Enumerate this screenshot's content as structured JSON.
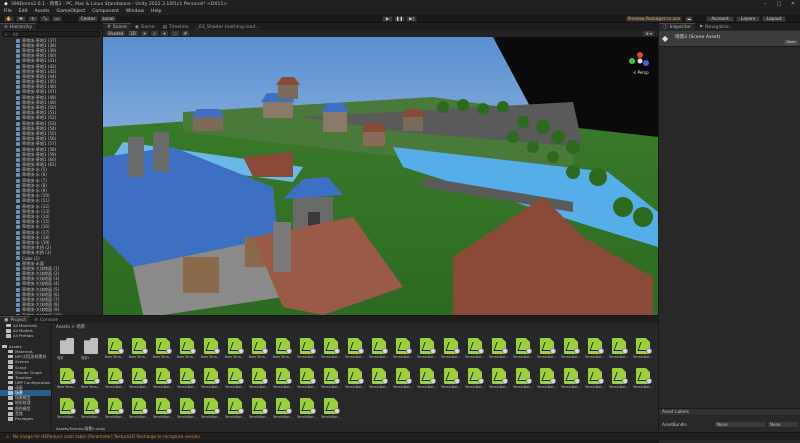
{
  "window": {
    "title": "398Demo2.0.1 - 场景2 - PC, Mac & Linux Standalone - Unity 2022.3.10f1c1 Personal* <DX11>",
    "controls": [
      "–",
      "□",
      "✕"
    ]
  },
  "menu": [
    "File",
    "Edit",
    "Assets",
    "GameObject",
    "Component",
    "Window",
    "Help"
  ],
  "toolbar": {
    "center": "Center",
    "local": "Local",
    "package_notice": "Preview Packages in use",
    "account": "Account",
    "layers": "Layers",
    "layout": "Layout",
    "play": "▶",
    "pause": "❚❚",
    "step": "▶|"
  },
  "hierarchy": {
    "tab": "Hierarchy",
    "search_placeholder": "All",
    "rows": [
      {
        "label": "草地块-草地1 (37)",
        "sel": false
      },
      {
        "label": "草地块-草地1 (38)",
        "sel": false
      },
      {
        "label": "草地块-草地1 (39)",
        "sel": false
      },
      {
        "label": "草地块-草地1 (40)",
        "sel": false
      },
      {
        "label": "草地块-草地1 (41)",
        "sel": false
      },
      {
        "label": "草地块-草地1 (42)",
        "sel": false
      },
      {
        "label": "草地块-草地1 (43)",
        "sel": false
      },
      {
        "label": "草地块-草地1 (44)",
        "sel": false
      },
      {
        "label": "草地块-草地1 (45)",
        "sel": false
      },
      {
        "label": "草地块-草地1 (46)",
        "sel": false
      },
      {
        "label": "草地块-草地1 (47)",
        "sel": false
      },
      {
        "label": "草地块-草地1 (48)",
        "sel": false
      },
      {
        "label": "草地块-草地1 (49)",
        "sel": false
      },
      {
        "label": "草地块-草地1 (50)",
        "sel": false
      },
      {
        "label": "草地块-草地1 (51)",
        "sel": false
      },
      {
        "label": "草地块-草地1 (52)",
        "sel": false
      },
      {
        "label": "草地块-草地1 (53)",
        "sel": false
      },
      {
        "label": "草地块-草地1 (54)",
        "sel": false
      },
      {
        "label": "草地块-草地1 (55)",
        "sel": false
      },
      {
        "label": "草地块-草地1 (56)",
        "sel": false
      },
      {
        "label": "草地块-草地1 (57)",
        "sel": false
      },
      {
        "label": "草地块-草地1 (58)",
        "sel": false
      },
      {
        "label": "草地块-草地1 (59)",
        "sel": false
      },
      {
        "label": "草地块-草地1 (60)",
        "sel": false
      },
      {
        "label": "草地块-草地1 (61)",
        "sel": false
      },
      {
        "label": "草地块-水 (5)",
        "sel": false
      },
      {
        "label": "草地块-水 (6)",
        "sel": false
      },
      {
        "label": "草地块-水 (7)",
        "sel": false
      },
      {
        "label": "草地块-水 (8)",
        "sel": false
      },
      {
        "label": "草地块-水 (9)",
        "sel": false
      },
      {
        "label": "草地块-水 (10)",
        "sel": false
      },
      {
        "label": "草地块-水 (11)",
        "sel": false
      },
      {
        "label": "草地块-水 (12)",
        "sel": false
      },
      {
        "label": "草地块-水 (13)",
        "sel": false
      },
      {
        "label": "草地块-水 (14)",
        "sel": false
      },
      {
        "label": "草地块-水 (15)",
        "sel": false
      },
      {
        "label": "草地块-水 (16)",
        "sel": false
      },
      {
        "label": "草地块-水 (17)",
        "sel": false
      },
      {
        "label": "草地块-水 (18)",
        "sel": false
      },
      {
        "label": "草地块-水 (19)",
        "sel": false
      },
      {
        "label": "草地块-木桥 (2)",
        "sel": false
      },
      {
        "label": "草地块-木桥 (3)",
        "sel": false
      },
      {
        "label": "Cube (1)",
        "sel": false
      },
      {
        "label": "草地块-水面",
        "sel": false
      },
      {
        "label": "草地块-大块地面 (1)",
        "sel": false
      },
      {
        "label": "草地块-大块地面 (2)",
        "sel": false
      },
      {
        "label": "草地块-大块地面 (3)",
        "sel": false
      },
      {
        "label": "草地块-大块地面 (4)",
        "sel": false
      },
      {
        "label": "草地块-大块地面 (5)",
        "sel": false
      },
      {
        "label": "草地块-大块地面 (6)",
        "sel": false
      },
      {
        "label": "草地块-大块地面 (7)",
        "sel": false
      },
      {
        "label": "草地块-大块地面 (8)",
        "sel": false
      },
      {
        "label": "草地块-大块地面 (9)",
        "sel": false
      },
      {
        "label": "草地块-大块地面 (10)",
        "sel": false
      },
      {
        "label": "草地块-大块地面 (11)",
        "sel": false
      },
      {
        "label": "草地块-大块地面 (12)",
        "sel": false
      },
      {
        "label": "草地块-大块地面 (13)",
        "sel": false
      },
      {
        "label": "Timeline",
        "sel": false
      }
    ]
  },
  "scene": {
    "tabs": [
      "Scene",
      "Game",
      "Timeline",
      "_03_Shader (nothing load..."
    ],
    "shading": "Shaded",
    "mode": "2D",
    "camera": "Camera",
    "persp": "< Persp"
  },
  "inspector": {
    "tabs": [
      "Inspector",
      "Navigation"
    ],
    "asset_name": "场景2 (Scene Asset)",
    "open_button": "Open",
    "asset_labels": "Asset Labels",
    "asset_bundle_label": "AssetBundle",
    "asset_bundle_value": "None",
    "variant_value": "None"
  },
  "project": {
    "tabs": [
      "Project",
      "Console"
    ],
    "tree": [
      {
        "label": "All Materials",
        "sel": false
      },
      {
        "label": "All Models",
        "sel": false
      },
      {
        "label": "All Prefabs",
        "sel": false
      },
      {
        "label": "",
        "sel": false
      },
      {
        "label": "Assets",
        "sel": false
      },
      {
        "label": "Materials",
        "sel": false
      },
      {
        "label": "NPC对话系统素材",
        "sel": false
      },
      {
        "label": "Scenes",
        "sel": false
      },
      {
        "label": "Script",
        "sel": false
      },
      {
        "label": "Shader Graph",
        "sel": false
      },
      {
        "label": "Timeline",
        "sel": false
      },
      {
        "label": "URP Configuration",
        "sel": false
      },
      {
        "label": "动画",
        "sel": false
      },
      {
        "label": "场景",
        "sel": true
      },
      {
        "label": "场景模型",
        "sel": false
      },
      {
        "label": "地形纹理",
        "sel": false
      },
      {
        "label": "角色模型",
        "sel": false
      },
      {
        "label": "音效",
        "sel": false
      },
      {
        "label": "Packages",
        "sel": false
      }
    ],
    "breadcrumb": "Assets > 场景",
    "folders": [
      "场景",
      "场景2"
    ],
    "file_prefix": "New Terra...",
    "terrain_label": "TerrainDat...",
    "footer_path": "Assets/Scenes/场景2.unity"
  },
  "status": {
    "message": "No image for HEReduce color table [Parameter] Texture2D Recharge to recognize version"
  },
  "colors": {
    "bg": "#191919",
    "panel": "#282828",
    "selection": "#2c5d87",
    "asset_green": "#9ad03a",
    "sky": "#8fb8e0",
    "grass": "#3f8a2e",
    "roof_blue": "#3d6fc2",
    "roof_red": "#8a4a38"
  }
}
